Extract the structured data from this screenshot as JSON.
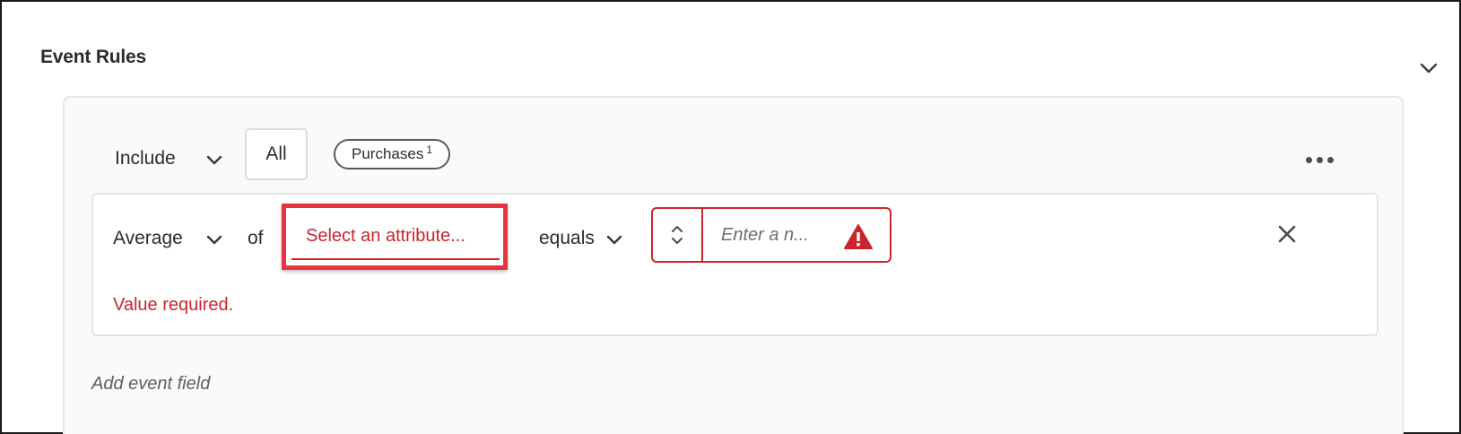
{
  "section": {
    "title": "Event Rules"
  },
  "rule": {
    "include_label": "Include",
    "match_label": "All",
    "event_chip": {
      "label": "Purchases",
      "count": "1"
    }
  },
  "condition": {
    "aggregation": "Average",
    "of_label": "of",
    "attribute_placeholder": "Select an attribute...",
    "operator": "equals",
    "value_placeholder": "Enter a n...",
    "error_message": "Value required."
  },
  "add_event_field_label": "Add event field",
  "colors": {
    "error": "#c9252d",
    "highlight": "#e8343f"
  }
}
